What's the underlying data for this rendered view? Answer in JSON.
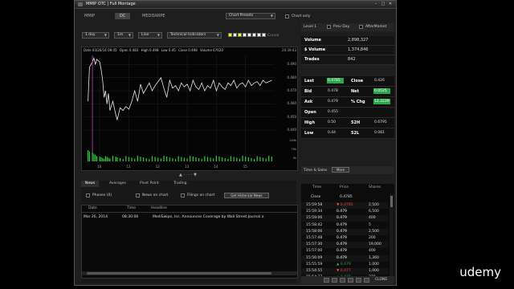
{
  "window": {
    "title": "MMIP OTC | Full Montage"
  },
  "top_tabs": [
    "MMIP",
    "DC",
    "MEDISWIPE"
  ],
  "chart_presets": "Chart Presets",
  "chart_only_label": "Chart only",
  "toolbar": {
    "range": "1 day",
    "interval": "1m",
    "style": "Line",
    "indicators": "Technical Indicators",
    "cursor_label": "Cursor",
    "colors": [
      "#ffff00",
      "#ffffff",
      "#ffff00",
      "#ffffff",
      "#ffffff",
      "#ffffff",
      "#ffffff",
      "#ffffff"
    ]
  },
  "chart_info": {
    "date": "Date 03/26/14 09:45",
    "open": "Open 0.483",
    "high": "High 0.498",
    "low": "Low 0.45",
    "close": "Close 0.498",
    "volume": "Volume 67620",
    "time": "20:39:43"
  },
  "chart_data": {
    "type": "line",
    "y_ticks": [
      "0.490",
      "0.480",
      "0.470",
      "0.460",
      "0.450",
      "0.440"
    ],
    "x_ticks": [
      "10",
      "11",
      "12",
      "13",
      "14",
      "15"
    ],
    "volume_ticks": [
      "140k",
      "70k",
      "0k"
    ],
    "ylim": [
      0.437,
      0.497
    ],
    "x": [
      9.6,
      9.65,
      9.75,
      9.8,
      9.85,
      9.9,
      10.0,
      10.05,
      10.1,
      10.15,
      10.2,
      10.25,
      10.3,
      10.35,
      10.45,
      10.55,
      10.6,
      10.7,
      10.8,
      10.9,
      11.0,
      11.1,
      11.2,
      11.3,
      11.4,
      11.5,
      11.6,
      11.7,
      11.8,
      11.9,
      12.0,
      12.1,
      12.2,
      12.3,
      12.4,
      12.5,
      12.6,
      12.7,
      12.8,
      12.9,
      13.0,
      13.1,
      13.2,
      13.3,
      13.4,
      13.5,
      13.6,
      13.7,
      13.8,
      13.9,
      14.0,
      14.1,
      14.2,
      14.3,
      14.4,
      14.5,
      14.6,
      14.7,
      14.8,
      14.9,
      15.0,
      15.1,
      15.2,
      15.3,
      15.4,
      15.5,
      15.6,
      15.7,
      15.8,
      15.9
    ],
    "values": [
      0.462,
      0.488,
      0.492,
      0.495,
      0.49,
      0.494,
      0.492,
      0.486,
      0.478,
      0.465,
      0.47,
      0.46,
      0.468,
      0.455,
      0.462,
      0.452,
      0.448,
      0.457,
      0.455,
      0.458,
      0.456,
      0.462,
      0.47,
      0.462,
      0.475,
      0.468,
      0.472,
      0.476,
      0.47,
      0.474,
      0.477,
      0.48,
      0.472,
      0.465,
      0.478,
      0.472,
      0.474,
      0.47,
      0.476,
      0.473,
      0.475,
      0.47,
      0.478,
      0.473,
      0.471,
      0.476,
      0.47,
      0.474,
      0.472,
      0.478,
      0.47,
      0.476,
      0.473,
      0.471,
      0.476,
      0.474,
      0.478,
      0.472,
      0.475,
      0.476,
      0.473,
      0.478,
      0.474,
      0.476,
      0.477,
      0.474,
      0.478,
      0.476,
      0.477,
      0.478
    ],
    "volume_color": "#2ecc40"
  },
  "lower_tabs": [
    "News",
    "Averages",
    "Pivot Point",
    "Trading"
  ],
  "news_filters": {
    "phones": "Phones (0)",
    "news_on_chart": "News on chart",
    "filings_on_chart": "Filings on chart",
    "get_historical": "Get Historical News"
  },
  "news_columns": [
    "Date",
    "Time",
    "Headline"
  ],
  "news_rows": [
    {
      "date": "Mar 26, 2014",
      "time": "08:30:06",
      "headline": "MediSwipe, Inc. Announces Coverage by Wall Street Journal a"
    }
  ],
  "level1": {
    "label": "Level 1",
    "prev_day": "Prev Day",
    "after_market": "AfterMarket"
  },
  "stats": [
    {
      "k": "Volume",
      "v": "2,898,327"
    },
    {
      "k": "$ Volume",
      "v": "1,374,846"
    },
    {
      "k": "Trades",
      "v": "842"
    }
  ],
  "quotes": [
    {
      "k": "Last",
      "v": "0.4785",
      "color": "#2aa84a"
    },
    {
      "k": "Close",
      "v": "0.426",
      "color": ""
    },
    {
      "k": "Bid",
      "v": "0.478",
      "color": ""
    },
    {
      "k": "Net",
      "v": "0.0525",
      "color": "#2aa84a"
    },
    {
      "k": "Ask",
      "v": "0.479",
      "color": ""
    },
    {
      "k": "% Chg",
      "v": "12.3239",
      "color": "#2aa84a"
    },
    {
      "k": "Open",
      "v": "0.455",
      "color": ""
    },
    {
      "k": "",
      "v": "",
      "color": ""
    },
    {
      "k": "High",
      "v": "0.50",
      "color": ""
    },
    {
      "k": "52H",
      "v": "0.6795",
      "color": ""
    },
    {
      "k": "Low",
      "v": "0.44",
      "color": ""
    },
    {
      "k": "52L",
      "v": "0.081",
      "color": ""
    }
  ],
  "time_sales": {
    "label": "Time & Sales",
    "more": "More"
  },
  "ts_columns": [
    "Time",
    "Price",
    "Shares"
  ],
  "ts_close": {
    "label": "Close",
    "price": "0.4785"
  },
  "ts_rows": [
    {
      "time": "15:59:58",
      "price": "0.4785",
      "shares": "2,500",
      "color": "#e24a4a",
      "arrow": "▼"
    },
    {
      "time": "15:59:34",
      "price": "0.479",
      "shares": "6,500",
      "color": "#ffffff",
      "arrow": ""
    },
    {
      "time": "15:59:06",
      "price": "0.479",
      "shares": "400",
      "color": "#ffffff",
      "arrow": ""
    },
    {
      "time": "15:58:42",
      "price": "0.479",
      "shares": "5",
      "color": "#ffffff",
      "arrow": ""
    },
    {
      "time": "15:58:06",
      "price": "0.479",
      "shares": "2,500",
      "color": "#ffffff",
      "arrow": ""
    },
    {
      "time": "15:57:48",
      "price": "0.479",
      "shares": "200",
      "color": "#ffffff",
      "arrow": ""
    },
    {
      "time": "15:57:30",
      "price": "0.479",
      "shares": "19,000",
      "color": "#ffffff",
      "arrow": ""
    },
    {
      "time": "15:57:00",
      "price": "0.479",
      "shares": "400",
      "color": "#ffffff",
      "arrow": ""
    },
    {
      "time": "15:56:09",
      "price": "0.479",
      "shares": "1,360",
      "color": "#ffffff",
      "arrow": ""
    },
    {
      "time": "15:55:59",
      "price": "0.479",
      "shares": "1,000",
      "color": "#2aa84a",
      "arrow": "▲"
    },
    {
      "time": "15:54:55",
      "price": "0.477",
      "shares": "1,000",
      "color": "#e24a4a",
      "arrow": "▼"
    },
    {
      "time": "15:54:37",
      "price": "0.479",
      "shares": "270",
      "color": "#2aa84a",
      "arrow": "▲"
    }
  ],
  "status": {
    "clone": "CLONE"
  },
  "watermark": "udemy"
}
